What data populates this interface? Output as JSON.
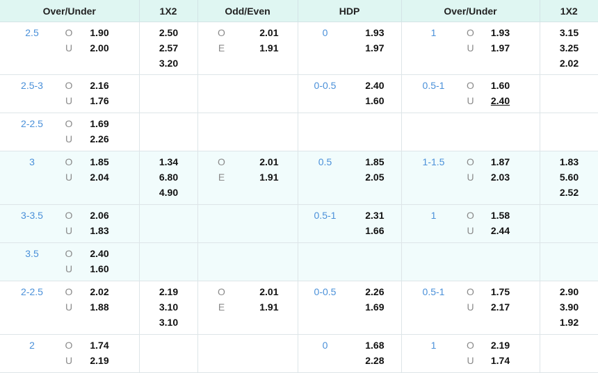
{
  "headers": [
    "Over/Under",
    "1X2",
    "Odd/Even",
    "HDP",
    "Over/Under",
    "1X2"
  ],
  "rows": [
    {
      "h": 75,
      "hl": false,
      "ou1": {
        "line": "2.5",
        "o": "1.90",
        "u": "2.00"
      },
      "x12a": [
        "2.50",
        "2.57",
        "3.20"
      ],
      "oe": {
        "o": "2.01",
        "e": "1.91"
      },
      "hdp": {
        "line": "0",
        "a": "1.93",
        "b": "1.97"
      },
      "ou2": {
        "line": "1",
        "o": "1.93",
        "u": "1.97"
      },
      "x12b": [
        "3.15",
        "3.25",
        "2.02"
      ]
    },
    {
      "h": 54,
      "hl": false,
      "ou1": {
        "line": "2.5-3",
        "o": "2.16",
        "u": "1.76"
      },
      "x12a": [],
      "oe": null,
      "hdp": {
        "line": "0-0.5",
        "a": "2.40",
        "b": "1.60"
      },
      "ou2": {
        "line": "0.5-1",
        "o": "1.60",
        "u": "2.40",
        "u_underline": true
      },
      "x12b": []
    },
    {
      "h": 54,
      "hl": false,
      "ou1": {
        "line": "2-2.5",
        "o": "1.69",
        "u": "2.26"
      },
      "x12a": [],
      "oe": null,
      "hdp": null,
      "ou2": null,
      "x12b": []
    },
    {
      "h": 76,
      "hl": true,
      "ou1": {
        "line": "3",
        "o": "1.85",
        "u": "2.04"
      },
      "x12a": [
        "1.34",
        "6.80",
        "4.90"
      ],
      "oe": {
        "o": "2.01",
        "e": "1.91"
      },
      "hdp": {
        "line": "0.5",
        "a": "1.85",
        "b": "2.05"
      },
      "ou2": {
        "line": "1-1.5",
        "o": "1.87",
        "u": "2.03"
      },
      "x12b": [
        "1.83",
        "5.60",
        "2.52"
      ]
    },
    {
      "h": 54,
      "hl": true,
      "ou1": {
        "line": "3-3.5",
        "o": "2.06",
        "u": "1.83"
      },
      "x12a": [],
      "oe": null,
      "hdp": {
        "line": "0.5-1",
        "a": "2.31",
        "b": "1.66"
      },
      "ou2": {
        "line": "1",
        "o": "1.58",
        "u": "2.44"
      },
      "x12b": []
    },
    {
      "h": 54,
      "hl": true,
      "ou1": {
        "line": "3.5",
        "o": "2.40",
        "u": "1.60"
      },
      "x12a": [],
      "oe": null,
      "hdp": null,
      "ou2": null,
      "x12b": []
    },
    {
      "h": 76,
      "hl": false,
      "ou1": {
        "line": "2-2.5",
        "o": "2.02",
        "u": "1.88"
      },
      "x12a": [
        "2.19",
        "3.10",
        "3.10"
      ],
      "oe": {
        "o": "2.01",
        "e": "1.91"
      },
      "hdp": {
        "line": "0-0.5",
        "a": "2.26",
        "b": "1.69"
      },
      "ou2": {
        "line": "0.5-1",
        "o": "1.75",
        "u": "2.17"
      },
      "x12b": [
        "2.90",
        "3.90",
        "1.92"
      ]
    },
    {
      "h": 54,
      "hl": false,
      "ou1": {
        "line": "2",
        "o": "1.74",
        "u": "2.19"
      },
      "x12a": [],
      "oe": null,
      "hdp": {
        "line": "0",
        "a": "1.68",
        "b": "2.28"
      },
      "ou2": {
        "line": "1",
        "o": "2.19",
        "u": "1.74"
      },
      "x12b": []
    }
  ],
  "labels": {
    "over": "O",
    "under": "U",
    "odd": "O",
    "even": "E"
  }
}
